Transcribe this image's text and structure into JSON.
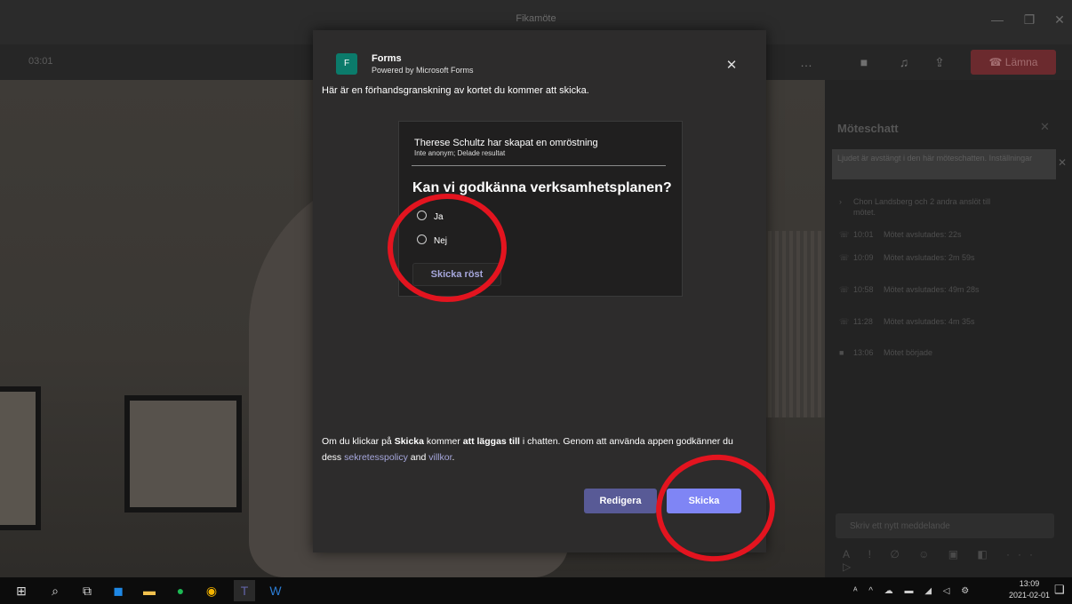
{
  "window": {
    "title": "Fikamöte",
    "minimize": "—",
    "maximize": "❐",
    "close": "✕"
  },
  "meeting": {
    "timer": "03:01",
    "leave_label": "Lämna",
    "controls": [
      "…",
      "■",
      "♫",
      "⇪"
    ]
  },
  "chat": {
    "title": "Möteschatt",
    "close": "✕",
    "banner": "Ljudet är avstängt i den här möteschatten. Inställningar",
    "events": [
      {
        "icon": "›",
        "time": "",
        "text": "Chon Landsberg och 2 andra anslöt till mötet."
      },
      {
        "icon": "☏",
        "time": "10:01",
        "text": "Mötet avslutades: 22s"
      },
      {
        "icon": "☏",
        "time": "10:09",
        "text": "Mötet avslutades: 2m 59s"
      },
      {
        "icon": "☏",
        "time": "10:58",
        "text": "Mötet avslutades: 49m 28s"
      },
      {
        "icon": "☏",
        "time": "11:28",
        "text": "Mötet avslutades: 4m 35s"
      },
      {
        "icon": "■",
        "time": "13:06",
        "text": "Mötet började"
      }
    ],
    "input_placeholder": "Skriv ett nytt meddelande",
    "tools": "A ! ∅ ☺ ▣ ◧ ··· ▷"
  },
  "dialog": {
    "app_name": "Forms",
    "powered_by": "Powered by Microsoft Forms",
    "close": "✕",
    "preview_note": "Här är en förhandsgranskning av kortet du kommer att skicka.",
    "card": {
      "creator": "Therese Schultz har skapat en omröstning",
      "meta": "Inte anonym; Delade resultat",
      "question": "Kan vi godkänna verksamhetsplanen?",
      "options": [
        "Ja",
        "Nej"
      ],
      "vote_label": "Skicka röst"
    },
    "consent": {
      "p1": "Om du klickar på ",
      "b1": "Skicka",
      "p2": " kommer ",
      "b2": "att läggas till",
      "p3": " i chatten. Genom att använda appen godkänner du dess ",
      "link1": "sekretesspolicy",
      "p4": " and ",
      "link2": "villkor",
      "p5": "."
    },
    "edit_label": "Redigera",
    "send_label": "Skicka"
  },
  "taskbar": {
    "tray": "ᴬ ^ ☁ ▬ ◢ ◁ ⚙",
    "time": "13:09",
    "date": "2021-02-01",
    "notif": "❑"
  },
  "colors": {
    "accent": "#7f85f5",
    "accent_dark": "#585a96",
    "annotation": "#e3141f",
    "forms_green": "#0b7b6b"
  }
}
